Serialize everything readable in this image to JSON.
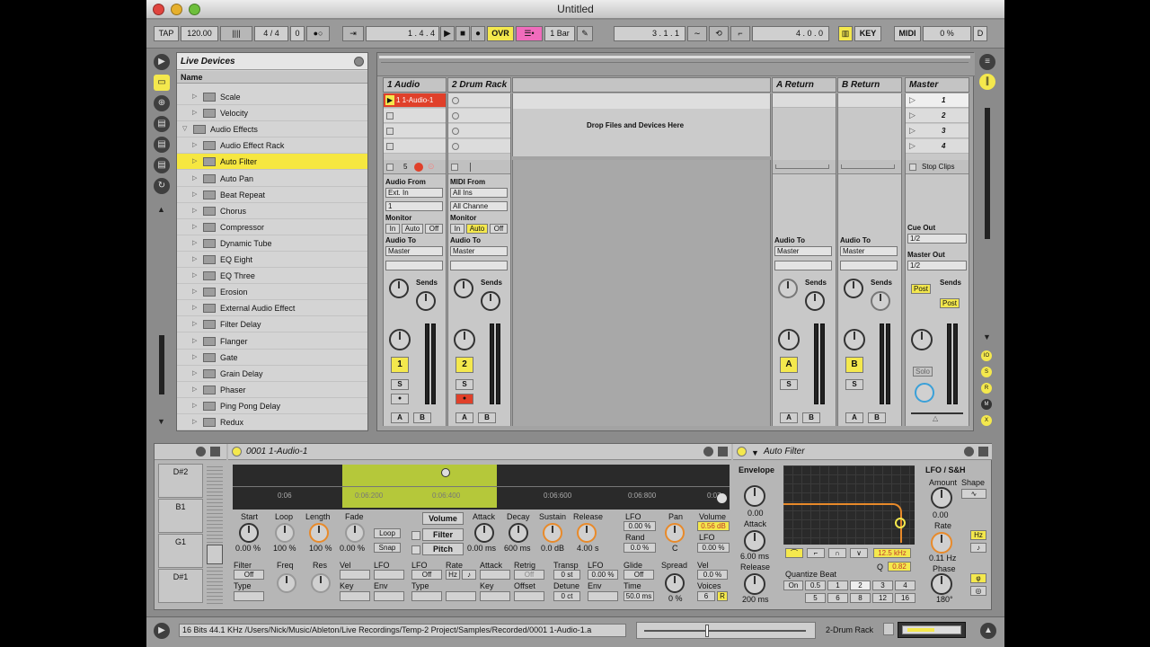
{
  "window": {
    "title": "Untitled"
  },
  "control_bar": {
    "tap": "TAP",
    "tempo": "120.00",
    "meter_icon": "||||",
    "signature": "4 / 4",
    "groove": "0",
    "metro": "●○",
    "follow": "⇥",
    "position": "1 .  4 .  4",
    "ovr": "OVR",
    "quant": "1 Bar",
    "loop_start": "3 .  1 .  1",
    "loop_length": "4 .  0 .  0",
    "key": "KEY",
    "midi": "MIDI",
    "cpu": "0 %",
    "d": "D"
  },
  "browser": {
    "title": "Live Devices",
    "col_header": "Name",
    "items": [
      {
        "label": "Scale",
        "indent": 2,
        "selected": false
      },
      {
        "label": "Velocity",
        "indent": 2,
        "selected": false
      },
      {
        "label": "Audio Effects",
        "indent": 1,
        "selected": false
      },
      {
        "label": "Audio Effect Rack",
        "indent": 2,
        "selected": false
      },
      {
        "label": "Auto Filter",
        "indent": 2,
        "selected": true
      },
      {
        "label": "Auto Pan",
        "indent": 2,
        "selected": false
      },
      {
        "label": "Beat Repeat",
        "indent": 2,
        "selected": false
      },
      {
        "label": "Chorus",
        "indent": 2,
        "selected": false
      },
      {
        "label": "Compressor",
        "indent": 2,
        "selected": false
      },
      {
        "label": "Dynamic Tube",
        "indent": 2,
        "selected": false
      },
      {
        "label": "EQ Eight",
        "indent": 2,
        "selected": false
      },
      {
        "label": "EQ Three",
        "indent": 2,
        "selected": false
      },
      {
        "label": "Erosion",
        "indent": 2,
        "selected": false
      },
      {
        "label": "External Audio Effect",
        "indent": 2,
        "selected": false
      },
      {
        "label": "Filter Delay",
        "indent": 2,
        "selected": false
      },
      {
        "label": "Flanger",
        "indent": 2,
        "selected": false
      },
      {
        "label": "Gate",
        "indent": 2,
        "selected": false
      },
      {
        "label": "Grain Delay",
        "indent": 2,
        "selected": false
      },
      {
        "label": "Phaser",
        "indent": 2,
        "selected": false
      },
      {
        "label": "Ping Pong Delay",
        "indent": 2,
        "selected": false
      },
      {
        "label": "Redux",
        "indent": 2,
        "selected": false
      }
    ]
  },
  "session": {
    "tracks": {
      "t1": "1 Audio",
      "t2": "2 Drum Rack",
      "a": "A Return",
      "b": "B Return",
      "master": "Master"
    },
    "clip1": "1 1-Audio-1",
    "drop_text": "Drop Files and Devices Here",
    "scenes": [
      "1",
      "2",
      "3",
      "4"
    ],
    "stop_clips": "Stop Clips",
    "t1_arm_num": "5",
    "audio_from": "Audio From",
    "ext_in": "Ext. In",
    "ch1": "1",
    "midi_from": "MIDI From",
    "all_ins": "All Ins",
    "all_channels": "All Channe",
    "monitor": "Monitor",
    "in": "In",
    "auto": "Auto",
    "off": "Off",
    "audio_to": "Audio To",
    "master_out_sel": "Master",
    "cue_out": "Cue Out",
    "cue_val": "1/2",
    "master_out": "Master Out",
    "master_val": "1/2",
    "sends": "Sends",
    "post": "Post",
    "num1": "1",
    "num2": "2",
    "numA": "A",
    "numB": "B",
    "s": "S",
    "ab_a": "A",
    "ab_b": "B",
    "solo": "Solo"
  },
  "clip_view": {
    "scenes": [
      "D#2",
      "B1",
      "G1",
      "D#1"
    ],
    "title": "0001 1-Audio-1",
    "time_marks": [
      "0:06",
      "0:06:200",
      "0:06:400",
      "0:06:600",
      "0:06:800",
      "0:07"
    ],
    "start": "Start",
    "start_val": "0.00 %",
    "loop": "Loop",
    "loop_val": "100 %",
    "length": "Length",
    "length_val": "100 %",
    "fade": "Fade",
    "fade_val": "0.00 %",
    "loop_btn": "Loop",
    "snap_btn": "Snap",
    "tab_volume": "Volume",
    "tab_filter": "Filter",
    "tab_pitch": "Pitch",
    "attack": "Attack",
    "attack_val": "0.00 ms",
    "decay": "Decay",
    "decay_val": "600 ms",
    "sustain": "Sustain",
    "sustain_val": "0.0 dB",
    "release": "Release",
    "release_val": "4.00 s",
    "lfo": "LFO",
    "lfo_val": "0.00 %",
    "rand": "Rand",
    "rand_val": "0.0 %",
    "pan": "Pan",
    "pan_val": "C",
    "volume": "Volume",
    "volume_val": "0.56 dB",
    "lfo2": "LFO",
    "lfo2_val": "0.00 %",
    "filter": "Filter",
    "filter_val": "Off",
    "type": "Type",
    "freq": "Freq",
    "res": "Res",
    "vel": "Vel",
    "lfo3": "LFO",
    "key": "Key",
    "env": "Env",
    "lfo4": "LFO",
    "lfo4_val": "Off",
    "rate": "Rate",
    "rate_val": "Hz",
    "attack2": "Attack",
    "retrig": "Retrig",
    "retrig_val": "Off",
    "type2": "Type",
    "key2": "Key",
    "offset": "Offset",
    "transp": "Transp",
    "transp_val": "0 st",
    "lfo5": "LFO",
    "lfo5_val": "0.00 %",
    "glide": "Glide",
    "glide_val": "Off",
    "detune": "Detune",
    "detune_val": "0 ct",
    "env2": "Env",
    "time": "Time",
    "time_val": "50.0 ms",
    "spread": "Spread",
    "spread_val": "0 %",
    "vel2": "Vel",
    "vel2_val": "0.0 %",
    "voices": "Voices",
    "voices_val": "6",
    "r": "R"
  },
  "auto_filter": {
    "title": "Auto Filter",
    "envelope": "Envelope",
    "env_val": "0.00",
    "attack": "Attack",
    "attack_val": "6.00 ms",
    "release": "Release",
    "release_val": "200 ms",
    "freq_val": "12.5 kHz",
    "q": "Q",
    "q_val": "0.82",
    "quantize": "Quantize Beat",
    "q_on": "On",
    "q_vals": [
      "0.5",
      "1",
      "2",
      "3",
      "4",
      "5",
      "6",
      "8",
      "12",
      "16"
    ],
    "lfo_sh": "LFO / S&H",
    "amount": "Amount",
    "amount_val": "0.00",
    "shape": "Shape",
    "rate": "Rate",
    "rate_val": "0.11 Hz",
    "hz": "Hz",
    "phase": "Phase",
    "phase_val": "180°"
  },
  "status": {
    "text": "16 Bits 44.1 KHz /Users/Nick/Music/Ableton/Live Recordings/Temp-2 Project/Samples/Recorded/0001 1-Audio-1.a",
    "track": "2-Drum Rack"
  },
  "colors": {
    "accent_yellow": "#f4e84d",
    "clip_red": "#e0402a",
    "loop_green": "#b5c83a"
  }
}
